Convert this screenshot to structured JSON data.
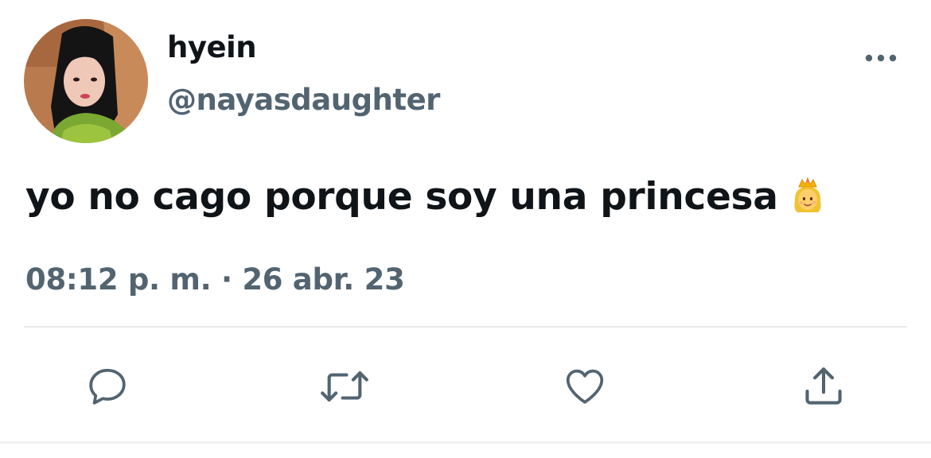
{
  "user": {
    "display_name": "hyein",
    "handle": "@nayasdaughter"
  },
  "tweet": {
    "text": "yo no cago porque soy una princesa",
    "emoji_icon": "princess-emoji",
    "time": "08:12 p. m.",
    "separator": " · ",
    "date": "26 abr. 23"
  },
  "actions": [
    {
      "icon": "reply-icon"
    },
    {
      "icon": "retweet-icon"
    },
    {
      "icon": "like-icon"
    },
    {
      "icon": "share-icon"
    }
  ],
  "colors": {
    "text_primary": "#0f1419",
    "text_secondary": "#536471",
    "divider": "#e7e9eb"
  }
}
